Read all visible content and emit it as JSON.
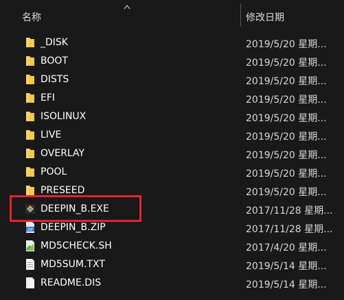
{
  "header": {
    "name_col": "名称",
    "date_col": "修改日期"
  },
  "files": [
    {
      "name": "_DISK",
      "date": "2019/5/20 星期...",
      "type": "folder"
    },
    {
      "name": "BOOT",
      "date": "2019/5/20 星期...",
      "type": "folder"
    },
    {
      "name": "DISTS",
      "date": "2019/5/20 星期...",
      "type": "folder"
    },
    {
      "name": "EFI",
      "date": "2019/5/20 星期...",
      "type": "folder"
    },
    {
      "name": "ISOLINUX",
      "date": "2019/5/20 星期...",
      "type": "folder"
    },
    {
      "name": "LIVE",
      "date": "2019/5/20 星期...",
      "type": "folder"
    },
    {
      "name": "OVERLAY",
      "date": "2019/5/20 星期...",
      "type": "folder"
    },
    {
      "name": "POOL",
      "date": "2019/5/20 星期...",
      "type": "folder"
    },
    {
      "name": "PRESEED",
      "date": "2019/5/20 星期...",
      "type": "folder"
    },
    {
      "name": "DEEPIN_B.EXE",
      "date": "2017/11/28 星期...",
      "type": "exe"
    },
    {
      "name": "DEEPIN_B.ZIP",
      "date": "2017/11/28 星期...",
      "type": "zip"
    },
    {
      "name": "MD5CHECK.SH",
      "date": "2017/4/20 星期...",
      "type": "script"
    },
    {
      "name": "MD5SUM.TXT",
      "date": "2019/5/14 星期...",
      "type": "text"
    },
    {
      "name": "README.DIS",
      "date": "2019/5/14 星期...",
      "type": "text"
    }
  ],
  "colors": {
    "background": "#191919",
    "folder": "#f3c94c",
    "highlight": "#e8222b"
  }
}
